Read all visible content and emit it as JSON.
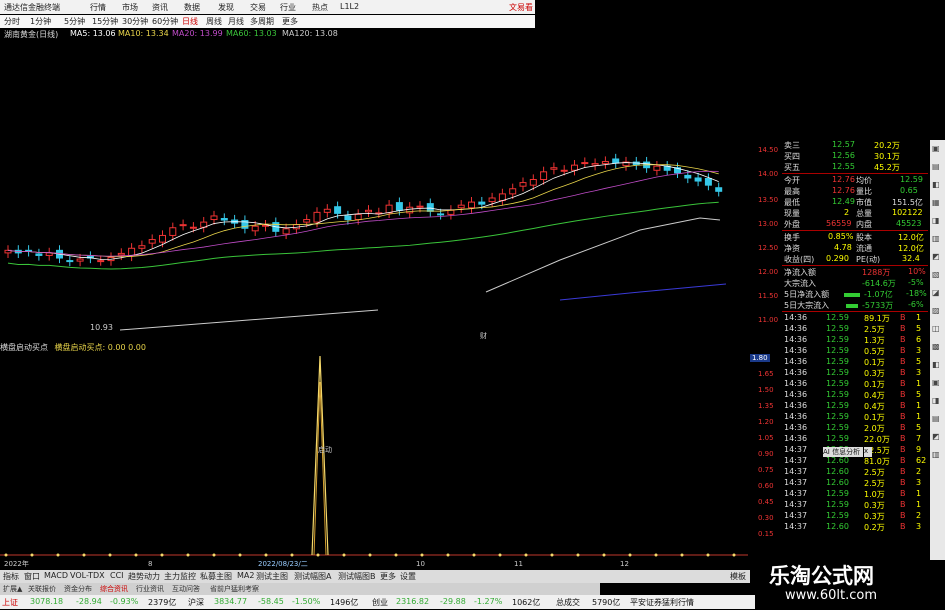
{
  "window": {
    "title": "通达信金融终端",
    "brand": "文易看"
  },
  "menu": {
    "items": [
      "分时",
      "1分钟",
      "5分钟",
      "15分钟",
      "30分钟",
      "60分钟",
      "日线",
      "周线",
      "月线",
      "多周期",
      "更多"
    ]
  },
  "topmenu": {
    "items": [
      "行情",
      "市场",
      "资讯",
      "数据",
      "发现",
      "交易",
      "行业",
      "热点",
      "L1L2"
    ]
  },
  "info": {
    "stock": "湖南黄金(日线)",
    "ma5": "MA5: 13.06",
    "ma10": "MA10: 13.34",
    "ma20": "MA20: 13.99",
    "ma60": "MA60: 13.03",
    "ma120": "MA120: 13.08"
  },
  "chart": {
    "low_label": "10.93",
    "marker": "财",
    "indicator_label": "启动"
  },
  "price_scale": [
    "14.50",
    "14.00",
    "13.50",
    "13.00",
    "12.50",
    "12.00",
    "11.50",
    "11.00"
  ],
  "low_scale": [
    "1.80",
    "1.65",
    "1.50",
    "1.35",
    "1.20",
    "1.05",
    "0.90",
    "0.75",
    "0.60",
    "0.45",
    "0.30",
    "0.15"
  ],
  "indicator_title": {
    "name": "横盘启动买点",
    "params": "横盘启动买点: 0.00  0.00"
  },
  "date_marker": "2022/08/23/二",
  "x_labels": [
    "2022年",
    "8",
    "9",
    "10",
    "11",
    "12"
  ],
  "quote": {
    "sell_rows": [
      {
        "label": "卖三",
        "price": "12.57",
        "vol": "20.2万"
      },
      {
        "label": "买四",
        "price": "12.56",
        "vol": "30.1万"
      },
      {
        "label": "买五",
        "price": "12.55",
        "vol": "45.2万"
      }
    ],
    "stats": [
      {
        "l1": "今开",
        "v1": "12.76",
        "l2": "均价",
        "v2": "12.59"
      },
      {
        "l1": "最高",
        "v1": "12.76",
        "l2": "量比",
        "v2": "0.65"
      },
      {
        "l1": "最低",
        "v1": "12.49",
        "l2": "市值",
        "v2": "151.5亿"
      },
      {
        "l1": "现量",
        "v1": "2",
        "l2": "总量",
        "v2": "102122"
      },
      {
        "l1": "外盘",
        "v1": "56559",
        "l2": "内盘",
        "v2": "45523"
      },
      {
        "l1": "换手",
        "v1": "0.85%",
        "l2": "股本",
        "v2": "12.0亿"
      },
      {
        "l1": "净资",
        "v1": "4.78",
        "l2": "流通",
        "v2": "12.0亿"
      },
      {
        "l1": "收益(四)",
        "v1": "0.290",
        "l2": "PE(动)",
        "v2": "32.4"
      }
    ],
    "flows": [
      {
        "label": "净流入额",
        "val": "1288万",
        "pct": "10%"
      },
      {
        "label": "大宗流入",
        "val": "-614.6万",
        "pct": "-5%"
      },
      {
        "label": "5日净流入额",
        "val": "-1.07亿",
        "pct": "-18%"
      },
      {
        "label": "5日大宗流入",
        "val": "-5733万",
        "pct": "-6%"
      }
    ],
    "ticks": [
      {
        "t": "14:36",
        "p": "12.59",
        "v": "89.1万",
        "s": "B",
        "n": "1"
      },
      {
        "t": "14:36",
        "p": "12.59",
        "v": "2.5万",
        "s": "B",
        "n": "5"
      },
      {
        "t": "14:36",
        "p": "12.59",
        "v": "1.3万",
        "s": "B",
        "n": "6"
      },
      {
        "t": "14:36",
        "p": "12.59",
        "v": "0.5万",
        "s": "B",
        "n": "3"
      },
      {
        "t": "14:36",
        "p": "12.59",
        "v": "0.1万",
        "s": "B",
        "n": "5"
      },
      {
        "t": "14:36",
        "p": "12.59",
        "v": "0.3万",
        "s": "B",
        "n": "3"
      },
      {
        "t": "14:36",
        "p": "12.59",
        "v": "0.1万",
        "s": "B",
        "n": "1"
      },
      {
        "t": "14:36",
        "p": "12.59",
        "v": "0.4万",
        "s": "B",
        "n": "5"
      },
      {
        "t": "14:36",
        "p": "12.59",
        "v": "0.4万",
        "s": "B",
        "n": "1"
      },
      {
        "t": "14:36",
        "p": "12.59",
        "v": "0.1万",
        "s": "B",
        "n": "1"
      },
      {
        "t": "14:36",
        "p": "12.59",
        "v": "2.0万",
        "s": "B",
        "n": "5"
      },
      {
        "t": "14:36",
        "p": "12.59",
        "v": "22.0万",
        "s": "B",
        "n": "7"
      },
      {
        "t": "14:37",
        "p": "12.59",
        "v": "12.5万",
        "s": "B",
        "n": "9"
      },
      {
        "t": "14:37",
        "p": "12.60",
        "v": "81.0万",
        "s": "B",
        "n": "62"
      },
      {
        "t": "14:37",
        "p": "12.60",
        "v": "2.5万",
        "s": "B",
        "n": "2"
      },
      {
        "t": "14:37",
        "p": "12.60",
        "v": "2.5万",
        "s": "B",
        "n": "3"
      },
      {
        "t": "14:37",
        "p": "12.59",
        "v": "1.0万",
        "s": "B",
        "n": "1"
      },
      {
        "t": "14:37",
        "p": "12.59",
        "v": "0.3万",
        "s": "B",
        "n": "1"
      },
      {
        "t": "14:37",
        "p": "12.59",
        "v": "0.3万",
        "s": "B",
        "n": "2"
      },
      {
        "t": "14:37",
        "p": "12.60",
        "v": "0.2万",
        "s": "B",
        "n": "3"
      }
    ],
    "popup": "AI 信息分析",
    "popup_close": "x"
  },
  "tabs": [
    "指标",
    "窗口",
    "MACD",
    "VOL-TDX",
    "CCI",
    "趋势动力",
    "主力监控",
    "私募主图",
    "MA2",
    "测试主图",
    "测试幅图A",
    "测试幅图B",
    "更多",
    "设置"
  ],
  "tabs_right": "模板",
  "subtabs": [
    "扩展▲",
    "关联报价",
    "资金分布",
    "综合资讯",
    "行业资讯",
    "互动问答",
    "省前户猛利考察"
  ],
  "status": {
    "sh_label": "上证",
    "sh_val": "3078.18",
    "sh_chg": "-28.94",
    "sh_pct": "-0.93%",
    "sh_amt": "2379亿",
    "sz_label": "沪深",
    "sz_val": "3834.77",
    "sz_chg": "-58.45",
    "sz_pct": "-1.50%",
    "sz_amt": "1496亿",
    "cy_label": "创业",
    "cy_val": "2316.82",
    "cy_chg": "-29.88",
    "cy_pct": "-1.27%",
    "cy_amt": "1062亿",
    "total_label": "总成交",
    "total_val": "5790亿",
    "broker": "平安证券猛利行情"
  },
  "watermark": {
    "cn": "乐淘公式网",
    "url": "www.60lt.com"
  },
  "colors": {
    "up": "#e33",
    "down": "#36c8e8",
    "ma5": "#ffffff",
    "ma10": "#e8d44a",
    "ma20": "#c04cc8",
    "ma60": "#3ac43a",
    "ma120": "#cccccc"
  }
}
